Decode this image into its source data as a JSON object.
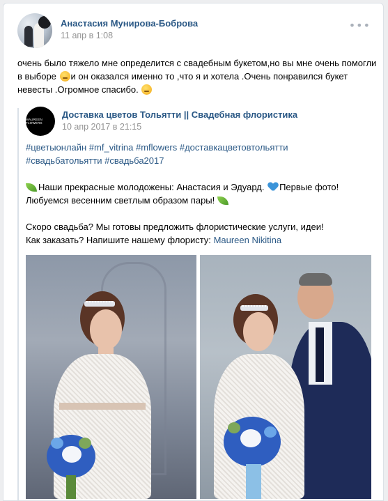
{
  "post": {
    "author": "Анастасия Мунирова-Боброва",
    "date": "11 апр в 1:08",
    "more": "•••",
    "text_part1": "очень было тяжело мне определится с свадебным букетом,но вы мне очень помогли в выборе",
    "text_part2": "и он оказался именно то ,что я и хотела .Очень понравился букет невесты .Огромное спасибо."
  },
  "repost": {
    "group_avatar_text": "MAUREEN FLOWERS",
    "group_name": "Доставка цветов Тольятти || Свадебная флористика",
    "date": "10 апр 2017 в 21:15",
    "hashtags_line1": "#цветыонлайн #mf_vitrina #mflowers #доставкацветовтольятти",
    "hashtags_line2": "#свадьбатольятти #свадьба2017",
    "line1_a": "Наши прекрасные молодожены: Анастасия и Эдуард.",
    "line1_b": "Первые фото!",
    "line2": "Любуемся весенним светлым образом пары!",
    "line3": "Скоро свадьба? Мы готовы предложить флористические услуги, идеи!",
    "line4_a": "Как заказать? Напишите нашему флористу:",
    "line4_link": "Maureen Nikitina"
  },
  "icons": {
    "more": "more-dots-icon",
    "emoji1": "grimace-emoji-icon",
    "emoji2": "wink-emoji-icon",
    "leaf": "leaf-emoji-icon",
    "heart": "blue-heart-emoji-icon"
  },
  "colors": {
    "link": "#2a5885",
    "meta": "#939393",
    "background": "#edeef0"
  }
}
